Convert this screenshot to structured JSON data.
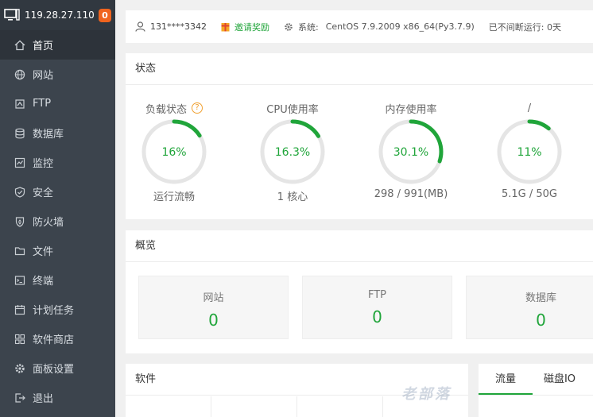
{
  "server": {
    "ip": "119.28.27.110",
    "badge": "0"
  },
  "menu": [
    {
      "label": "首页",
      "icon": "home-icon",
      "active": true
    },
    {
      "label": "网站",
      "icon": "globe-icon"
    },
    {
      "label": "FTP",
      "icon": "ftp-icon"
    },
    {
      "label": "数据库",
      "icon": "database-icon"
    },
    {
      "label": "监控",
      "icon": "monitor-icon"
    },
    {
      "label": "安全",
      "icon": "shield-icon"
    },
    {
      "label": "防火墙",
      "icon": "firewall-icon"
    },
    {
      "label": "文件",
      "icon": "folder-icon"
    },
    {
      "label": "终端",
      "icon": "terminal-icon"
    },
    {
      "label": "计划任务",
      "icon": "calendar-icon"
    },
    {
      "label": "软件商店",
      "icon": "apps-icon"
    },
    {
      "label": "面板设置",
      "icon": "gear-icon"
    },
    {
      "label": "退出",
      "icon": "logout-icon"
    }
  ],
  "topbar": {
    "user": "131****3342",
    "invite": "邀请奖励",
    "system_label": "系统:",
    "system_value": "CentOS 7.9.2009 x86_64(Py3.7.9)",
    "uptime": "已不间断运行: 0天"
  },
  "status": {
    "title": "状态",
    "gauges": [
      {
        "label": "负载状态",
        "value_text": "16%",
        "value": 16,
        "sub": "运行流畅",
        "help": "?"
      },
      {
        "label": "CPU使用率",
        "value_text": "16.3%",
        "value": 16.3,
        "sub": "1 核心"
      },
      {
        "label": "内存使用率",
        "value_text": "30.1%",
        "value": 30.1,
        "sub": "298 / 991(MB)"
      },
      {
        "label": "/",
        "value_text": "11%",
        "value": 11,
        "sub": "5.1G / 50G"
      }
    ]
  },
  "overview": {
    "title": "概览",
    "cards": [
      {
        "label": "网站",
        "value": "0"
      },
      {
        "label": "FTP",
        "value": "0"
      },
      {
        "label": "数据库",
        "value": "0"
      }
    ]
  },
  "software": {
    "title": "软件"
  },
  "traffic": {
    "tabs": [
      "流量",
      "磁盘IO"
    ]
  },
  "watermark": "老部落",
  "colors": {
    "accent": "#20a53a",
    "sidebar": "#3c444d",
    "badge": "#f0641e",
    "track": "#e5e5e5"
  }
}
